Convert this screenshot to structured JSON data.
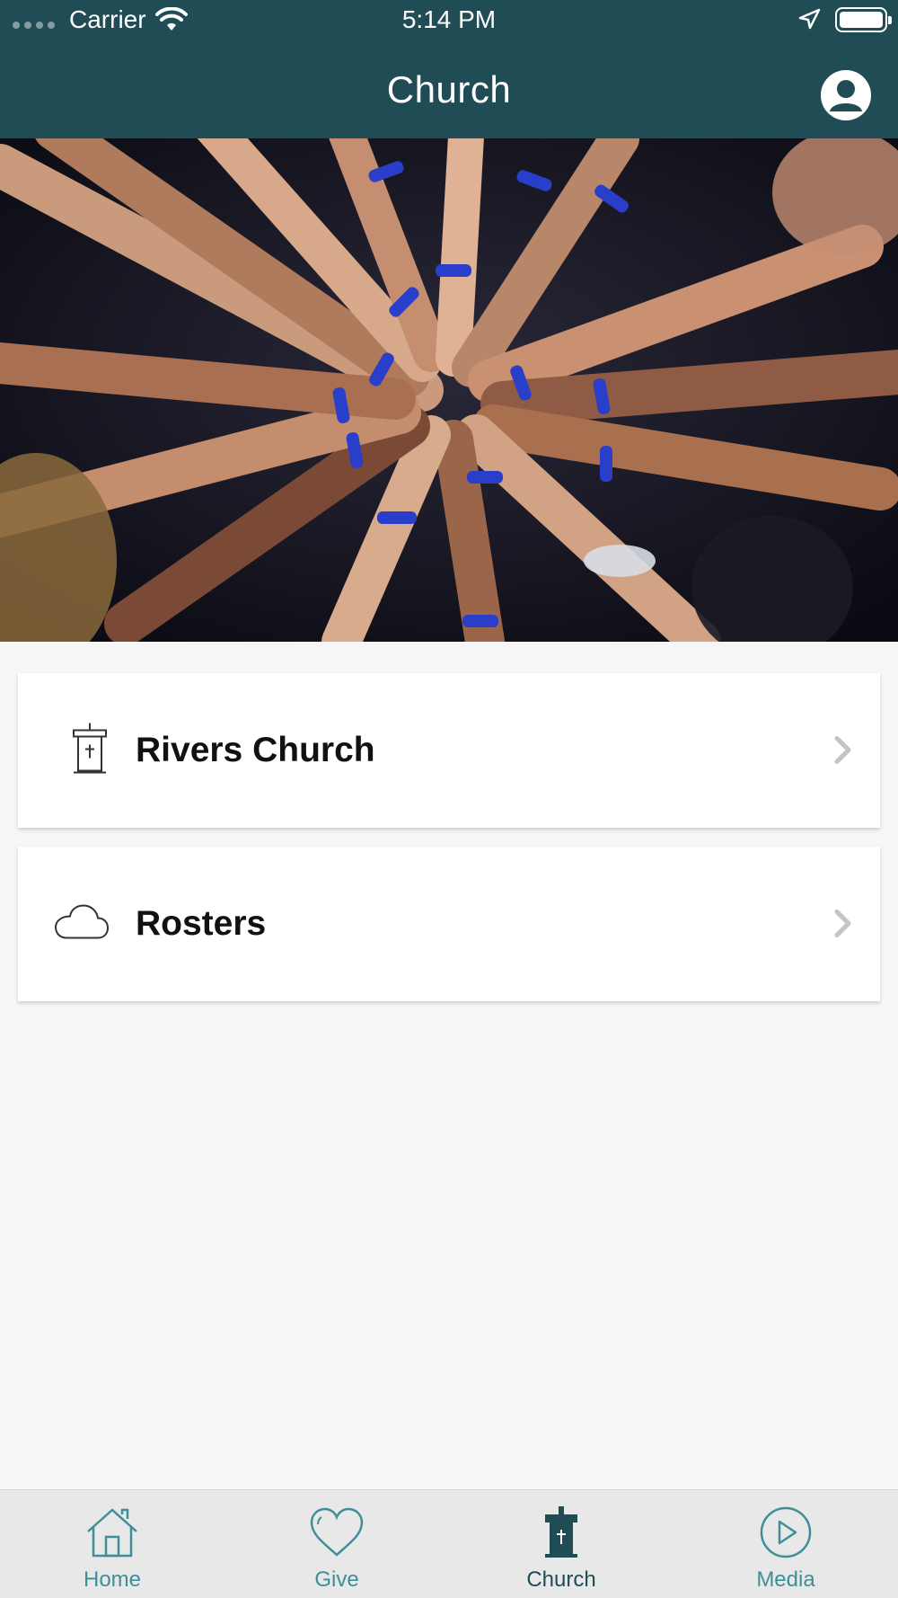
{
  "status_bar": {
    "carrier": "Carrier",
    "time": "5:14 PM"
  },
  "header": {
    "title": "Church",
    "profile_icon": "person-circle-icon"
  },
  "hero": {
    "description_icon": "group-hands-photo"
  },
  "list": [
    {
      "label": "Rivers Church",
      "icon": "pulpit-icon"
    },
    {
      "label": "Rosters",
      "icon": "cloud-icon"
    }
  ],
  "tabs": [
    {
      "label": "Home",
      "icon": "home-icon",
      "active": false
    },
    {
      "label": "Give",
      "icon": "heart-icon",
      "active": false
    },
    {
      "label": "Church",
      "icon": "pulpit-icon",
      "active": true
    },
    {
      "label": "Media",
      "icon": "play-circle-icon",
      "active": false
    }
  ],
  "colors": {
    "header_bg": "#204c55",
    "tab_inactive": "#3f8f99",
    "tab_active": "#204c55",
    "page_bg": "#f6f6f6"
  }
}
